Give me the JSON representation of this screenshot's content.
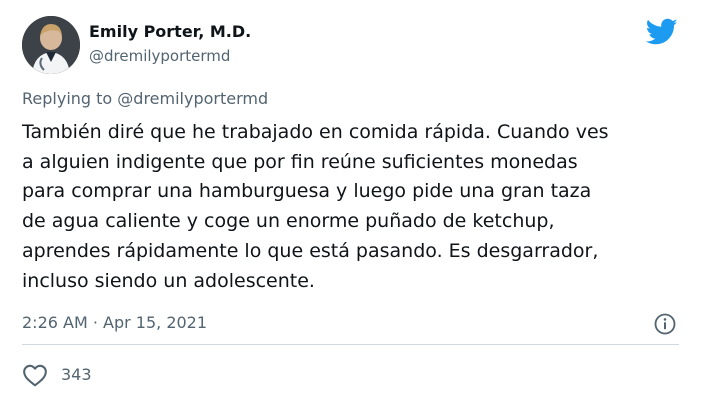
{
  "author": {
    "name": "Emily Porter, M.D.",
    "handle": "@dremilyportermd"
  },
  "reply": {
    "label": "Replying to @dremilyportermd"
  },
  "tweet": {
    "text": "También diré que he trabajado en comida rápida. Cuando ves\na alguien indigente que por fin reúne suficientes monedas\npara comprar una hamburguesa y luego pide una gran taza\nde agua caliente y coge un enorme puñado de ketchup,\naprendes rápidamente lo que está pasando. Es desgarrador,\nincluso siendo un adolescente."
  },
  "meta": {
    "timestamp": "2:26 AM · Apr 15, 2021"
  },
  "engagement": {
    "likes": "343"
  },
  "icons": {
    "brand": "twitter-bird-icon",
    "info": "info-icon",
    "like": "heart-icon"
  },
  "colors": {
    "brand": "#1d9bf0",
    "text": "#0f1419",
    "muted": "#536471",
    "divider": "#cfd9de"
  }
}
